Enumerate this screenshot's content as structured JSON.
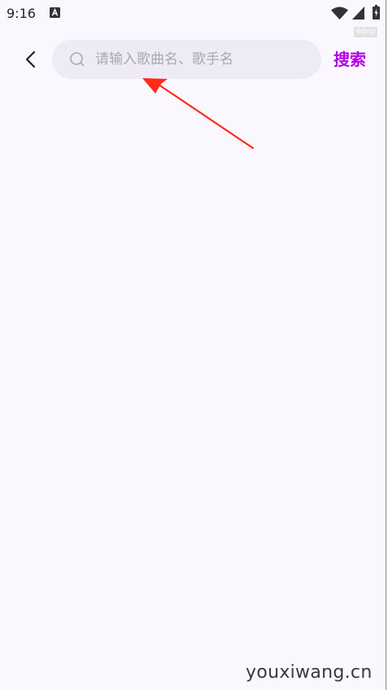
{
  "status_bar": {
    "time": "9:16",
    "notification_icon": "a-letter-notification-icon",
    "wifi_icon": "wifi-icon",
    "signal_icon": "cell-signal-icon",
    "battery_icon": "battery-charging-icon",
    "speed_badge": "68np"
  },
  "header": {
    "back_icon": "chevron-left-icon",
    "search": {
      "icon": "search-icon",
      "placeholder": "请输入歌曲名、歌手名",
      "value": ""
    },
    "search_button_label": "搜索"
  },
  "annotation": {
    "icon": "red-arrow-icon",
    "color": "#ff2a1a"
  },
  "colors": {
    "background": "#faf8fe",
    "search_box": "#eeebf6",
    "accent": "#b400e6",
    "placeholder": "#a9a7b3"
  },
  "watermark": "youxiwang.cn"
}
